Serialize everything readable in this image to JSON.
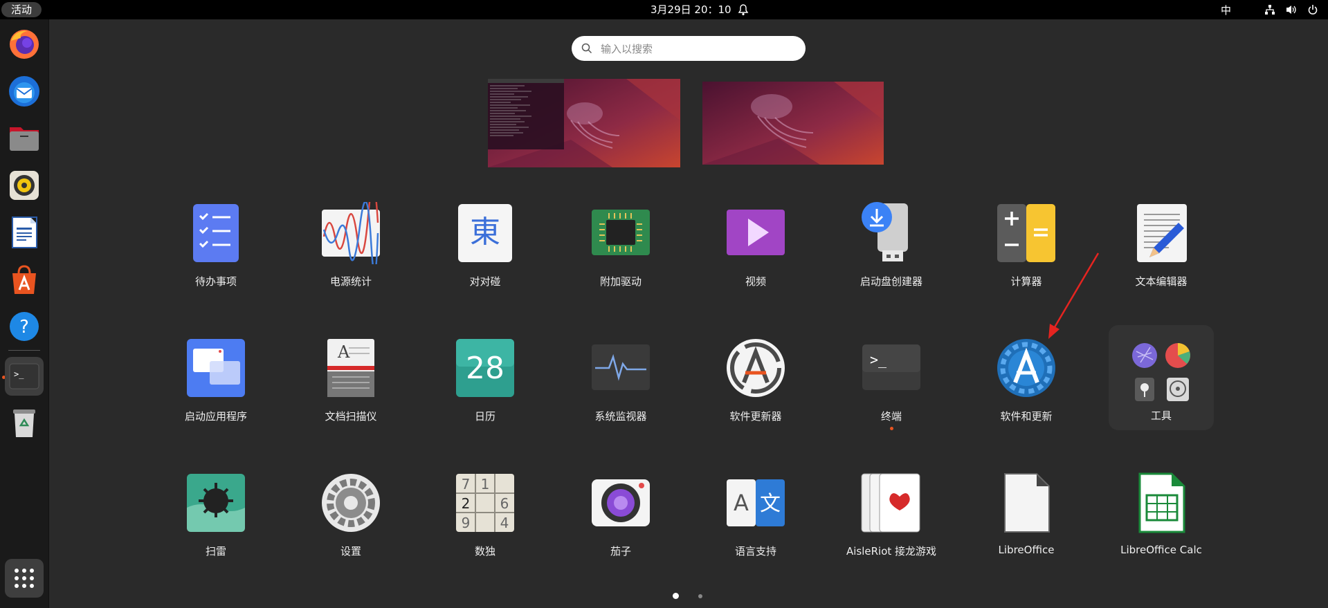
{
  "topbar": {
    "activities": "活动",
    "datetime": "3月29日  20：10",
    "input_method": "中",
    "tray_icons": [
      "network-icon",
      "volume-icon",
      "power-icon"
    ]
  },
  "dock": {
    "items": [
      "firefox",
      "thunderbird",
      "files",
      "rhythmbox",
      "libreoffice-writer",
      "app-center",
      "help",
      "terminal",
      "trash",
      "show-apps"
    ]
  },
  "search": {
    "placeholder": "输入以搜索"
  },
  "apps": {
    "r1": [
      "待办事项",
      "电源统计",
      "对对碰",
      "附加驱动",
      "视频",
      "启动盘创建器",
      "计算器",
      "文本编辑器"
    ],
    "r2": [
      "启动应用程序",
      "文档扫描仪",
      "日历",
      "系统监视器",
      "软件更新器",
      "终端",
      "软件和更新",
      "工具"
    ],
    "r3": [
      "扫雷",
      "设置",
      "数独",
      "茄子",
      "语言支持",
      "AisleRiot 接龙游戏",
      "LibreOffice",
      "LibreOffice Calc"
    ]
  },
  "icon_text": {
    "calendar_day": "28",
    "sudoku": [
      "7",
      "1",
      "2",
      "6",
      "9",
      "4"
    ],
    "kanji": "東",
    "lang_a": "A",
    "lang_zh": "文",
    "scanner_a": "A",
    "term_prompt": ">_"
  },
  "colors": {
    "accent": "#e95420",
    "background": "#2a2a2a",
    "annotation_arrow": "#e52420"
  }
}
